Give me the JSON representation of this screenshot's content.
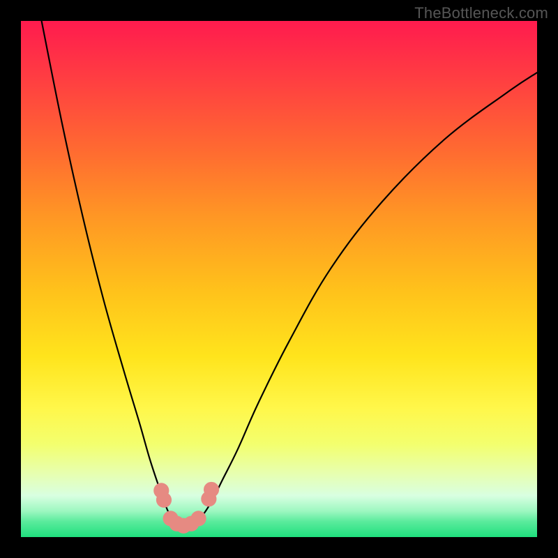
{
  "watermark": "TheBottleneck.com",
  "chart_data": {
    "type": "line",
    "title": "",
    "xlabel": "",
    "ylabel": "",
    "xlim": [
      0,
      100
    ],
    "ylim": [
      0,
      100
    ],
    "series": [
      {
        "name": "curve",
        "x": [
          4,
          8,
          12,
          16,
          20,
          23,
          25,
          27,
          28.5,
          30,
          31.5,
          33,
          35,
          37,
          39,
          42,
          46,
          52,
          60,
          70,
          82,
          94,
          100
        ],
        "y": [
          100,
          80,
          62,
          46,
          32,
          22,
          15,
          9,
          5,
          2.5,
          2,
          2.5,
          4,
          7,
          11,
          17,
          26,
          38,
          52,
          65,
          77,
          86,
          90
        ]
      }
    ],
    "markers": [
      {
        "x": 27.2,
        "y": 9.0,
        "r": 1.5
      },
      {
        "x": 27.7,
        "y": 7.2,
        "r": 1.5
      },
      {
        "x": 29.0,
        "y": 3.6,
        "r": 1.5
      },
      {
        "x": 30.2,
        "y": 2.6,
        "r": 1.5
      },
      {
        "x": 31.5,
        "y": 2.2,
        "r": 1.5
      },
      {
        "x": 33.0,
        "y": 2.6,
        "r": 1.5
      },
      {
        "x": 34.4,
        "y": 3.6,
        "r": 1.5
      },
      {
        "x": 36.4,
        "y": 7.4,
        "r": 1.5
      },
      {
        "x": 36.9,
        "y": 9.2,
        "r": 1.5
      }
    ],
    "gradient_stops": [
      {
        "pos": 0,
        "color": "#ff1b4e"
      },
      {
        "pos": 25,
        "color": "#ff6a31"
      },
      {
        "pos": 52,
        "color": "#ffc11b"
      },
      {
        "pos": 75,
        "color": "#fff74a"
      },
      {
        "pos": 92,
        "color": "#d8ffe1"
      },
      {
        "pos": 100,
        "color": "#1fe07e"
      }
    ]
  }
}
